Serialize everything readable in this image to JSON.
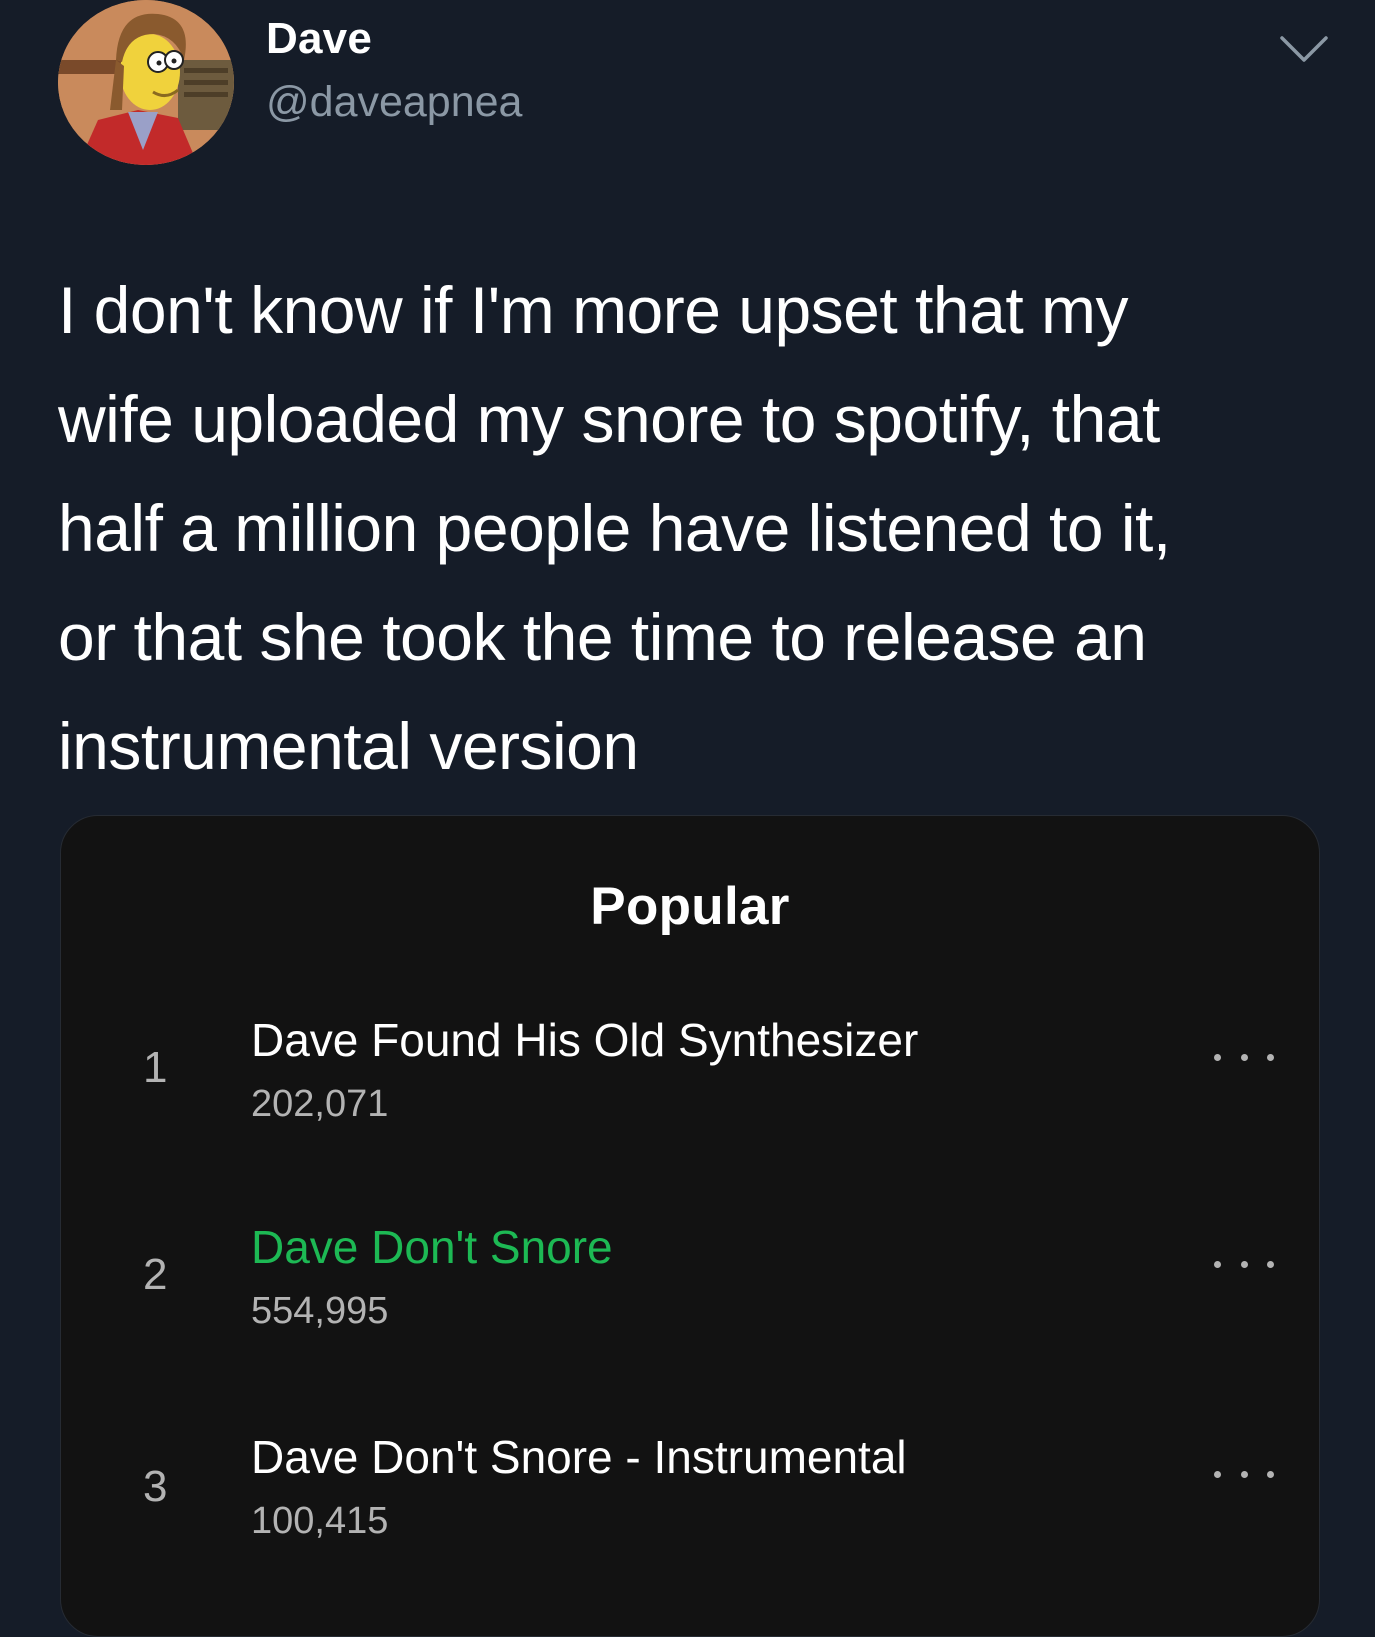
{
  "user": {
    "display_name": "Dave",
    "handle": "@daveapnea",
    "avatar_icon": "cartoon-avatar"
  },
  "tweet": {
    "lines": [
      "I don't know if I'm more upset that my",
      "wife uploaded my snore to spotify, that",
      "half a million people have listened to it,",
      "or that she took the time to release an",
      "instrumental version"
    ],
    "menu_icon": "chevron-down-icon"
  },
  "card": {
    "title": "Popular",
    "tracks": [
      {
        "rank": "1",
        "title": "Dave Found His Old Synthesizer",
        "plays": "202,071",
        "playing": false
      },
      {
        "rank": "2",
        "title": "Dave Don't Snore",
        "plays": "554,995",
        "playing": true
      },
      {
        "rank": "3",
        "title": "Dave Don't Snore - Instrumental",
        "plays": "100,415",
        "playing": false
      }
    ],
    "more_icon": "more-options-icon"
  },
  "colors": {
    "background": "#151c28",
    "card_background": "#121212",
    "accent_green": "#1db954",
    "secondary_text": "#8b98a5"
  }
}
